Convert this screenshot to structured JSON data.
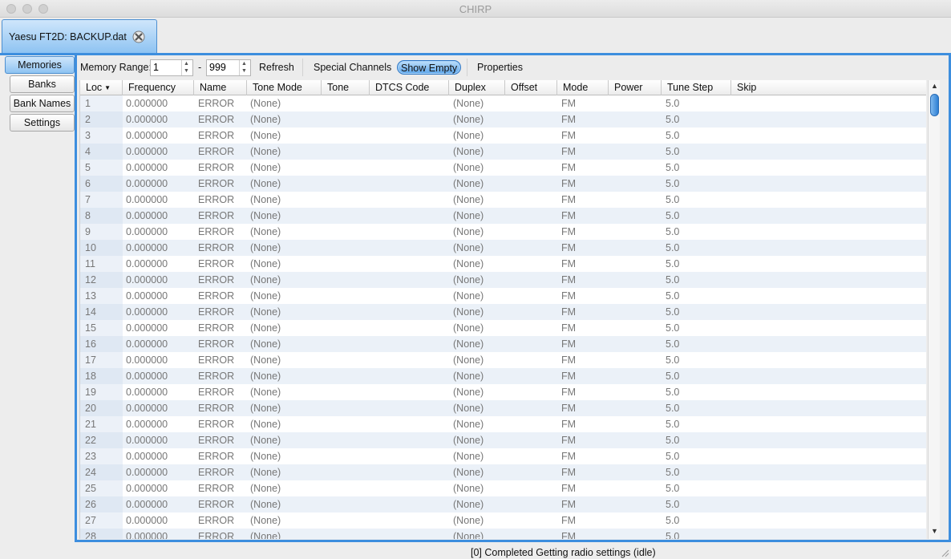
{
  "window": {
    "title": "CHIRP"
  },
  "file_tab": {
    "label": "Yaesu FT2D: BACKUP.dat"
  },
  "side_tabs": [
    "Memories",
    "Banks",
    "Bank Names",
    "Settings"
  ],
  "toolbar": {
    "range_label": "Memory Range:",
    "range_start": "1",
    "range_dash": "-",
    "range_end": "999",
    "refresh": "Refresh",
    "special_channels": "Special Channels",
    "show_empty": "Show Empty",
    "properties": "Properties"
  },
  "columns": [
    "Loc",
    "Frequency",
    "Name",
    "Tone Mode",
    "Tone",
    "DTCS Code",
    "Duplex",
    "Offset",
    "Mode",
    "Power",
    "Tune Step",
    "Skip"
  ],
  "row_defaults": {
    "frequency": "0.000000",
    "name": "ERROR",
    "tone_mode": "(None)",
    "tone": "",
    "dtcs": "",
    "duplex": "(None)",
    "offset": "",
    "mode": "FM",
    "power": "",
    "tune_step": "5.0",
    "skip": ""
  },
  "rows": [
    {
      "loc": "1"
    },
    {
      "loc": "2"
    },
    {
      "loc": "3"
    },
    {
      "loc": "4"
    },
    {
      "loc": "5"
    },
    {
      "loc": "6"
    },
    {
      "loc": "7"
    },
    {
      "loc": "8"
    },
    {
      "loc": "9"
    },
    {
      "loc": "10"
    },
    {
      "loc": "11"
    },
    {
      "loc": "12"
    },
    {
      "loc": "13"
    },
    {
      "loc": "14"
    },
    {
      "loc": "15"
    },
    {
      "loc": "16"
    },
    {
      "loc": "17"
    },
    {
      "loc": "18"
    },
    {
      "loc": "19"
    },
    {
      "loc": "20"
    },
    {
      "loc": "21"
    },
    {
      "loc": "22"
    },
    {
      "loc": "23"
    },
    {
      "loc": "24"
    },
    {
      "loc": "25"
    },
    {
      "loc": "26"
    },
    {
      "loc": "27"
    },
    {
      "loc": "28"
    }
  ],
  "status": {
    "text": "[0] Completed Getting radio settings (idle)"
  },
  "colors": {
    "accent": "#3d8ede",
    "row_alt": "#ebf1f8"
  }
}
